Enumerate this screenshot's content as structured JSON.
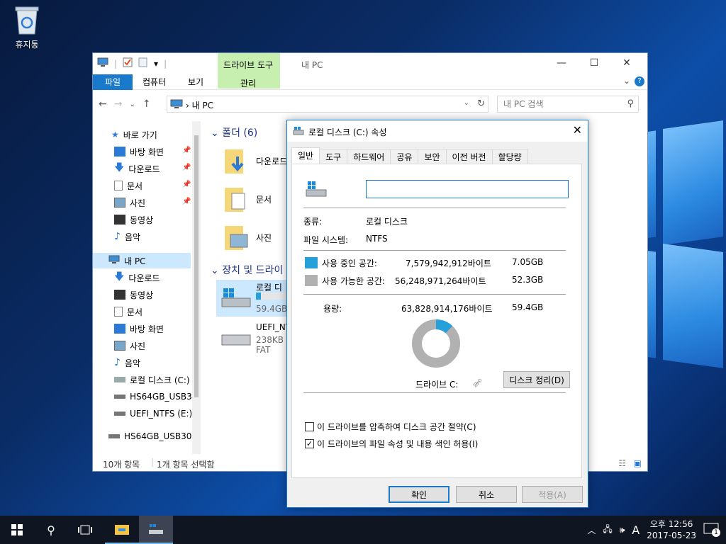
{
  "desktop": {
    "recycle_bin_label": "휴지통"
  },
  "explorer": {
    "title": "내 PC",
    "context_tab_group": "드라이브 도구",
    "context_tab": "관리",
    "ribbon_tabs": [
      "파일",
      "컴퓨터",
      "보기"
    ],
    "address": "내 PC",
    "search_placeholder": "내 PC 검색",
    "sidebar": {
      "quick_access": "바로 가기",
      "quick_items": [
        "바탕 화면",
        "다운로드",
        "문서",
        "사진",
        "동영상",
        "음악"
      ],
      "this_pc": "내 PC",
      "pc_items": [
        "다운로드",
        "동영상",
        "문서",
        "바탕 화면",
        "사진",
        "음악",
        "로컬 디스크 (C:)",
        "HS64GB_USB30",
        "UEFI_NTFS (E:)"
      ],
      "bottom_item": "HS64GB_USB30 ("
    },
    "content": {
      "folders_header": "폴더 (6)",
      "folders": [
        "다운로드",
        "문서",
        "사진"
      ],
      "devices_header": "장치 및 드라이",
      "drives": [
        {
          "name": "로컬 디",
          "detail": "59.4GB",
          "used_fraction": 0.12
        },
        {
          "name": "UEFI_NT",
          "detail": "238KB 중",
          "fs": "FAT"
        }
      ]
    },
    "status": {
      "items": "10개 항목",
      "selected": "1개 항목 선택함"
    }
  },
  "dialog": {
    "title": "로컬 디스크 (C:) 속성",
    "tabs": [
      "일반",
      "도구",
      "하드웨어",
      "공유",
      "보안",
      "이전 버전",
      "할당량"
    ],
    "name_value": "",
    "type_label": "종류:",
    "type_value": "로컬 디스크",
    "fs_label": "파일 시스템:",
    "fs_value": "NTFS",
    "used_label": "사용 중인 공간:",
    "used_bytes": "7,579,942,912바이트",
    "used_gb": "7.05GB",
    "free_label": "사용 가능한 공간:",
    "free_bytes": "56,248,971,264바이트",
    "free_gb": "52.3GB",
    "capacity_label": "용량:",
    "capacity_bytes": "63,828,914,176바이트",
    "capacity_gb": "59.4GB",
    "used_fraction": 0.119,
    "drive_label": "드라이브 C:",
    "cleanup_button": "디스크 정리(D)",
    "compress_label": "이 드라이브를 압축하여 디스크 공간 절약(C)",
    "compress_checked": false,
    "index_label": "이 드라이브의 파일 속성 및 내용 색인 허용(I)",
    "index_checked": true,
    "ok": "확인",
    "cancel": "취소",
    "apply": "적용(A)",
    "used_color": "#26a0da",
    "free_color": "#b1b1b1"
  },
  "taskbar": {
    "time": "오후 12:56",
    "date": "2017-05-23",
    "ime": "A",
    "notification_count": "1"
  }
}
